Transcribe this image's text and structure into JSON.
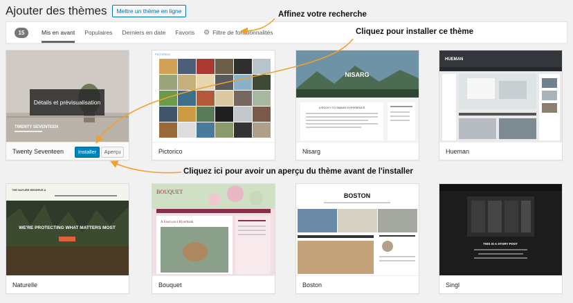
{
  "header": {
    "title": "Ajouter des thèmes",
    "upload_label": "Mettre un thème en ligne"
  },
  "filter_bar": {
    "count": "15",
    "tabs": [
      {
        "label": "Mis en avant",
        "active": true
      },
      {
        "label": "Populaires",
        "active": false
      },
      {
        "label": "Derniers en date",
        "active": false
      },
      {
        "label": "Favoris",
        "active": false
      }
    ],
    "feature_filter_label": "Filtre de fonctionnalités",
    "feature_filter_icon": "gear-icon"
  },
  "themes": [
    {
      "name": "Twenty Seventeen",
      "install_label": "Installer",
      "preview_label": "Aperçu",
      "overlay_label": "Détails et prévisualisation",
      "banner_text": "TWENTY SEVENTEEN"
    },
    {
      "name": "Pictorico",
      "logo": "PICTORICO"
    },
    {
      "name": "Nisarg",
      "banner_text": "NISARG",
      "post_title": "A ROCKY TO SMASH EXPERIENCE"
    },
    {
      "name": "Hueman",
      "logo": "HUEMAN"
    },
    {
      "name": "Naturelle",
      "logo": "THE NATURE RESERVE A",
      "banner_text": "WE'RE PROTECTING WHAT MATTERS MOST"
    },
    {
      "name": "Bouquet",
      "logo": "BOUQUET",
      "post_title": "A Fawn on a Riverbank"
    },
    {
      "name": "Boston",
      "logo": "BOSTON"
    },
    {
      "name": "Singl",
      "post_title": "THIS IS A STORY POST"
    }
  ],
  "annotations": {
    "refine": "Affinez votre recherche",
    "install": "Cliquez pour installer ce thème",
    "preview": "Cliquez ici pour avoir un aperçu du thème avant de l'installer"
  },
  "colors": {
    "accent": "#0085ba",
    "arrow": "#f0a030"
  }
}
